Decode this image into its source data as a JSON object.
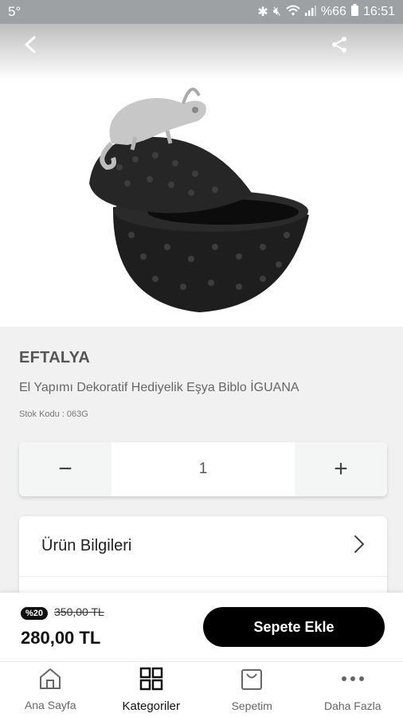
{
  "status_bar": {
    "left": "5°",
    "battery": "%66",
    "time": "16:51"
  },
  "product": {
    "brand": "EFTALYA",
    "title": "El Yapımı Dekoratif Hediyelik Eşya Biblo İGUANA",
    "stock_label": "Stok Kodu : 063G",
    "image_icon": "chameleon-box-image"
  },
  "quantity": {
    "minus": "−",
    "value": "1",
    "plus": "+"
  },
  "info_card": {
    "product_info_label": "Ürün Bilgileri"
  },
  "pricing": {
    "discount": "%20",
    "old_price": "350,00 TL",
    "new_price": "280,00 TL",
    "add_to_cart": "Sepete Ekle"
  },
  "nav": {
    "items": [
      {
        "label": "Ana Sayfa",
        "icon": "home-icon"
      },
      {
        "label": "Kategoriler",
        "icon": "grid-icon"
      },
      {
        "label": "Sepetim",
        "icon": "bag-icon"
      },
      {
        "label": "Daha Fazla",
        "icon": "more-icon"
      }
    ]
  }
}
